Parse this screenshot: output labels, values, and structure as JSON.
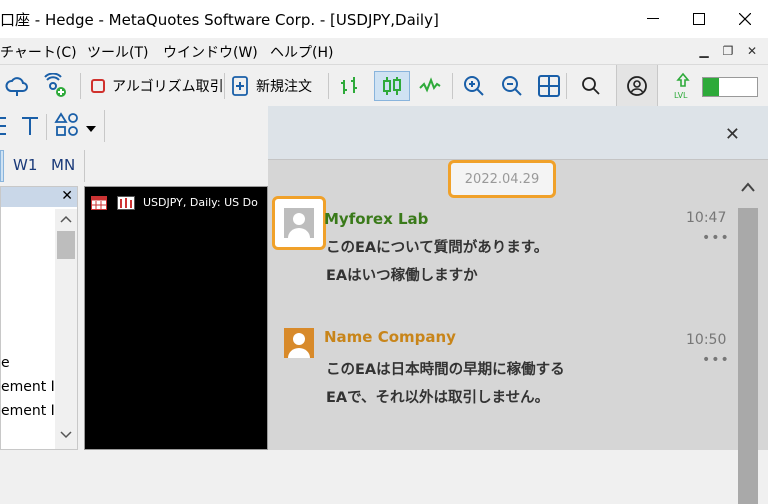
{
  "window": {
    "title": "口座 - Hedge - MetaQuotes Software Corp. - [USDJPY,Daily]"
  },
  "menu": {
    "items": [
      "チャート(C)",
      "ツール(T)",
      "ウインドウ(W)",
      "ヘルプ(H)"
    ]
  },
  "toolbar": {
    "algo_label": "アルゴリズム取引",
    "new_order_label": "新規注文"
  },
  "timeframes": [
    "W1",
    "MN"
  ],
  "left_panel": {
    "rows": [
      "e",
      "ement Ir",
      "ement Ir"
    ]
  },
  "chart": {
    "label": "USDJPY, Daily:  US Do"
  },
  "chat": {
    "date": "2022.04.29",
    "messages": [
      {
        "sender": "Myforex Lab",
        "time": "10:47",
        "lines": [
          "このEAについて質問があります。",
          "EAはいつ稼働しますか"
        ]
      },
      {
        "sender": "Name Company",
        "time": "10:50",
        "lines": [
          "このEAは日本時間の早期に稼働する",
          "EAで、それ以外は取引しません。"
        ]
      }
    ]
  },
  "colors": {
    "highlight": "#f0a12a",
    "sender_green": "#3a7a1a",
    "sender_orange": "#c8851a",
    "signal_green": "#2eaa3a"
  },
  "icons": {
    "profile": "person-circle-icon",
    "search": "magnifier-icon",
    "lvl": "level-icon"
  }
}
